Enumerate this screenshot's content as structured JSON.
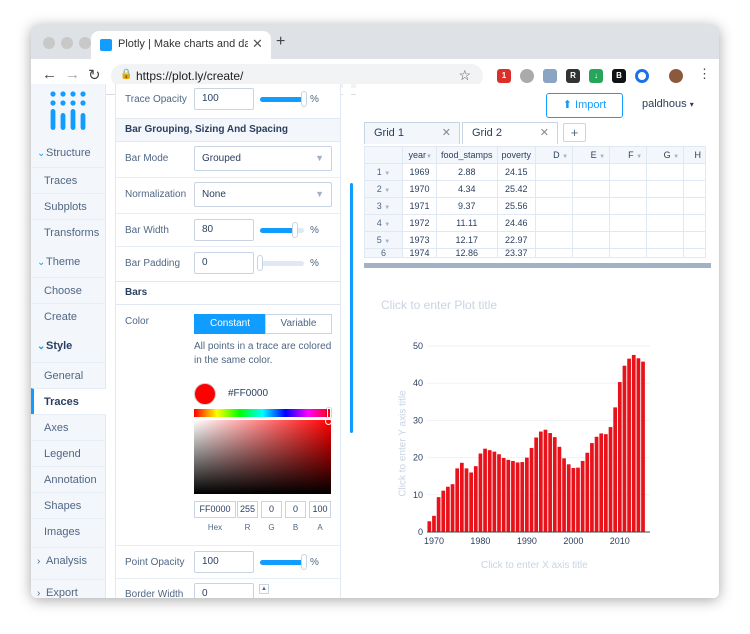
{
  "browser": {
    "tab_title": "Plotly | Make charts and dashb",
    "url": "https://plot.ly/create/",
    "ext_badge": "1"
  },
  "sidebar": {
    "sections": [
      {
        "label": "Structure",
        "items": [
          "Traces",
          "Subplots",
          "Transforms"
        ]
      },
      {
        "label": "Theme",
        "items": [
          "Choose",
          "Create"
        ]
      },
      {
        "label": "Style",
        "items": [
          "General",
          "Traces",
          "Axes",
          "Legend",
          "Annotation",
          "Shapes",
          "Images"
        ]
      },
      {
        "label": "Analysis",
        "items": []
      },
      {
        "label": "Export",
        "items": []
      }
    ],
    "active_item": "Traces"
  },
  "panel": {
    "trace_opacity_label": "Trace Opacity",
    "trace_opacity_value": "100",
    "pct": "%",
    "bar_group_header": "Bar Grouping, Sizing And Spacing",
    "bar_mode_label": "Bar Mode",
    "bar_mode_value": "Grouped",
    "normalization_label": "Normalization",
    "normalization_value": "None",
    "bar_width_label": "Bar Width",
    "bar_width_value": "80",
    "bar_padding_label": "Bar Padding",
    "bar_padding_value": "0",
    "bars_header": "Bars",
    "color_label": "Color",
    "color_mode_constant": "Constant",
    "color_mode_variable": "Variable",
    "color_hint": "All points in a trace are colored in the same color.",
    "color_hex": "#FF0000",
    "swatch_color": "#ff0000",
    "picker": {
      "hex": "FF0000",
      "r": "255",
      "g": "0",
      "b": "0",
      "a": "100",
      "hex_lbl": "Hex",
      "r_lbl": "R",
      "g_lbl": "G",
      "b_lbl": "B",
      "a_lbl": "A"
    },
    "point_opacity_label": "Point Opacity",
    "point_opacity_value": "100",
    "border_width_label": "Border Width",
    "border_width_value": "0",
    "levels": {
      "trace_opacity": 1.0,
      "bar_width": 0.8,
      "bar_padding": 0.0,
      "point_opacity": 1.0
    }
  },
  "main": {
    "import_label": "Import",
    "user": "paldhous",
    "grid_tabs": [
      "Grid 1",
      "Grid 2"
    ],
    "add_grid": "+",
    "columns": [
      "year",
      "food_stamps",
      "poverty",
      "D",
      "E",
      "F",
      "G",
      "H"
    ],
    "rows": [
      [
        "1",
        "1969",
        "2.88",
        "24.15"
      ],
      [
        "2",
        "1970",
        "4.34",
        "25.42"
      ],
      [
        "3",
        "1971",
        "9.37",
        "25.56"
      ],
      [
        "4",
        "1972",
        "11.11",
        "24.46"
      ],
      [
        "5",
        "1973",
        "12.17",
        "22.97"
      ],
      [
        "6",
        "1974",
        "12.86",
        "23.37"
      ]
    ],
    "plot_title_placeholder": "Click to enter Plot title",
    "x_axis_placeholder": "Click to enter X axis title",
    "y_axis_placeholder": "Click to enter Y axis title"
  },
  "chart_data": {
    "type": "bar",
    "title": "",
    "xlabel": "",
    "ylabel": "",
    "color": "#e8121a",
    "x_ticks": [
      "1970",
      "1980",
      "1990",
      "2000",
      "2010"
    ],
    "y_ticks": [
      "0",
      "10",
      "20",
      "30",
      "40",
      "50"
    ],
    "ylim": [
      0,
      50
    ],
    "xlim": [
      1968.5,
      2016.5
    ],
    "x": [
      1969,
      1970,
      1971,
      1972,
      1973,
      1974,
      1975,
      1976,
      1977,
      1978,
      1979,
      1980,
      1981,
      1982,
      1983,
      1984,
      1985,
      1986,
      1987,
      1988,
      1989,
      1990,
      1991,
      1992,
      1993,
      1994,
      1995,
      1996,
      1997,
      1998,
      1999,
      2000,
      2001,
      2002,
      2003,
      2004,
      2005,
      2006,
      2007,
      2008,
      2009,
      2010,
      2011,
      2012,
      2013,
      2014,
      2015
    ],
    "values": [
      2.88,
      4.34,
      9.37,
      11.11,
      12.17,
      12.86,
      17.1,
      18.6,
      17.1,
      16.0,
      17.7,
      21.1,
      22.4,
      22.0,
      21.6,
      20.9,
      19.9,
      19.4,
      19.1,
      18.7,
      18.8,
      20.0,
      22.6,
      25.4,
      27.0,
      27.5,
      26.6,
      25.5,
      22.9,
      19.8,
      18.2,
      17.2,
      17.3,
      19.1,
      21.3,
      23.9,
      25.6,
      26.5,
      26.3,
      28.2,
      33.5,
      40.3,
      44.7,
      46.6,
      47.6,
      46.7,
      45.8
    ]
  }
}
